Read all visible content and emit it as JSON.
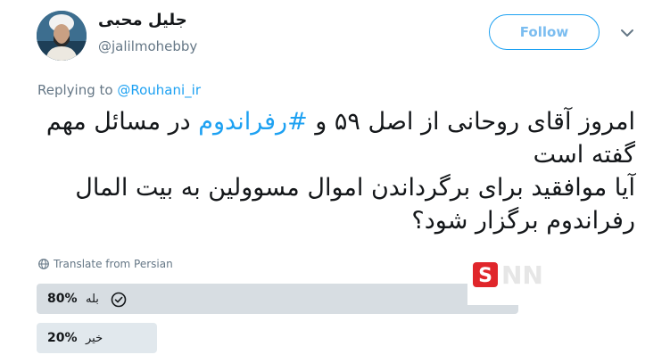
{
  "user": {
    "display_name": "جلیل محبی",
    "handle": "@jalilmohebby"
  },
  "follow_label": "Follow",
  "replying": {
    "prefix": "Replying to",
    "mention": "@Rouhani_ir"
  },
  "tweet": {
    "part1": "امروز آقای روحانی از اصل ۵۹ و",
    "hashtag": "#رفراندوم",
    "part2": "در مسائل مهم گفته است",
    "line2": "آیا موافقید برای برگرداندن اموال مسوولین به بیت المال رفراندوم برگزار شود؟"
  },
  "translate_label": "Translate from Persian",
  "poll": {
    "options": [
      {
        "percent": "80%",
        "label": "بله",
        "fraction": 0.8,
        "selected": true
      },
      {
        "percent": "20%",
        "label": "خیر",
        "fraction": 0.2,
        "selected": false
      }
    ]
  },
  "watermark": "SNN",
  "colors": {
    "accent": "#1da1f2",
    "watermark_red": "#e0262b",
    "poll_bar": "#d7dde2"
  },
  "icons": [
    "chevron-down-icon",
    "globe-icon",
    "check-circle-icon"
  ]
}
